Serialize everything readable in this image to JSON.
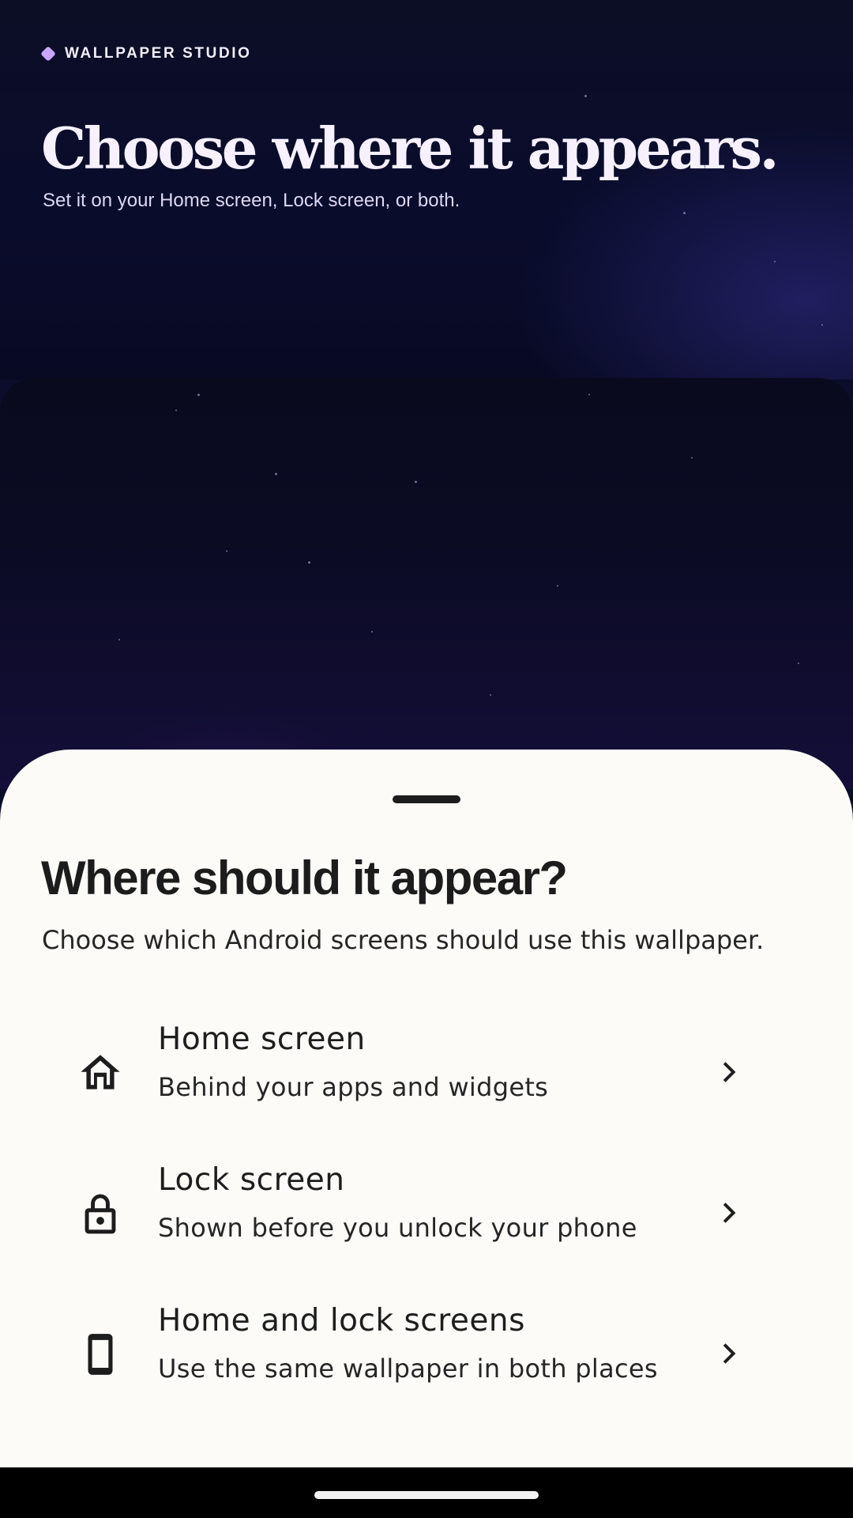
{
  "hero": {
    "brand": "WALLPAPER STUDIO",
    "title": "Choose where it appears.",
    "subtitle": "Set it on your Home screen, Lock screen, or both."
  },
  "sheet": {
    "title": "Where should it appear?",
    "subtitle": "Choose which Android screens should use this wallpaper.",
    "options": [
      {
        "title": "Home screen",
        "description": "Behind your apps and widgets",
        "icon": "home-icon"
      },
      {
        "title": "Lock screen",
        "description": "Shown before you unlock your phone",
        "icon": "lock-icon"
      },
      {
        "title": "Home and lock screens",
        "description": "Use the same wallpaper in both places",
        "icon": "phone-icon"
      }
    ]
  },
  "colors": {
    "accent": "#c6a6ff",
    "hero_background": "#0b0d2a",
    "sheet_background": "#fcfbf8",
    "text_primary": "#1c1c1c"
  }
}
